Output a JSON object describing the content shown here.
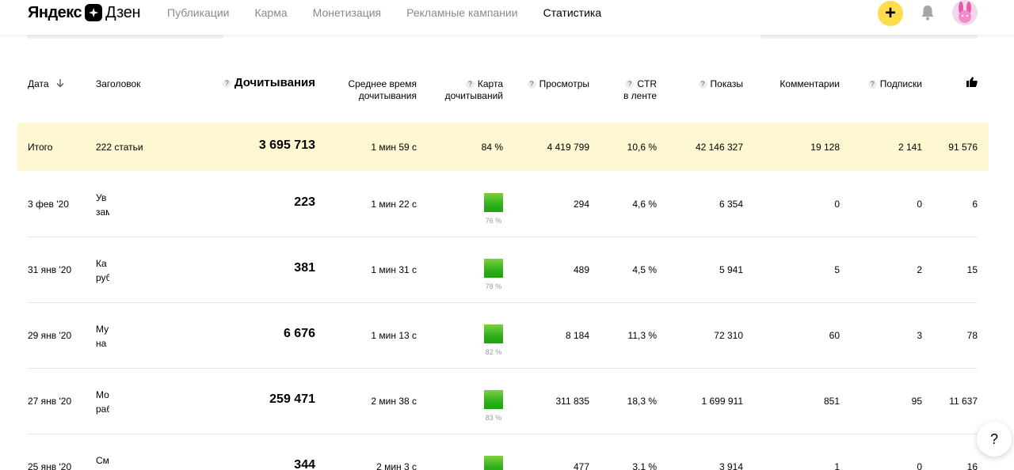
{
  "brand": {
    "yandex": "Яндекс",
    "dzen": "Дзен"
  },
  "nav": [
    {
      "label": "Публикации"
    },
    {
      "label": "Карма"
    },
    {
      "label": "Монетизация"
    },
    {
      "label": "Рекламные кампании"
    },
    {
      "label": "Статистика",
      "active": true
    }
  ],
  "header_icons": {
    "add": "+",
    "bell": "bell-icon",
    "avatar": "bunny-avatar"
  },
  "table": {
    "columns": {
      "date": "Дата",
      "title": "Заголовок",
      "reads": "Дочитывания",
      "avg_time_line1": "Среднее время",
      "avg_time_line2": "дочитывания",
      "map_line1": "Карта",
      "map_line2": "дочитываний",
      "views": "Просмотры",
      "ctr_line1": "CTR",
      "ctr_line2": "в ленте",
      "shows": "Показы",
      "comments": "Комментарии",
      "subs": "Подписки",
      "likes_icon": "thumbs-up-icon"
    },
    "help_mark": "?",
    "total": {
      "label": "Итого",
      "title": "222 статьи",
      "reads": "3 695 713",
      "avg_time": "1 мин 59 с",
      "map": "84 %",
      "views": "4 419 799",
      "ctr": "10,6 %",
      "shows": "42 146 327",
      "comments": "19 128",
      "subs": "2 141",
      "likes": "91 576"
    },
    "rows": [
      {
        "date": "3 фев '20",
        "title1": "Ув",
        "title2": "зам",
        "reads": "223",
        "avg_time": "1 мин 22 с",
        "map": "76 %",
        "views": "294",
        "ctr": "4,6 %",
        "shows": "6 354",
        "comments": "0",
        "subs": "0",
        "likes": "6"
      },
      {
        "date": "31 янв '20",
        "title1": "Ка",
        "title2": "руб",
        "reads": "381",
        "avg_time": "1 мин 31 с",
        "map": "78 %",
        "views": "489",
        "ctr": "4,5 %",
        "shows": "5 941",
        "comments": "5",
        "subs": "2",
        "likes": "15"
      },
      {
        "date": "29 янв '20",
        "title1": "Му",
        "title2": "на",
        "reads": "6 676",
        "avg_time": "1 мин 13 с",
        "map": "82 %",
        "views": "8 184",
        "ctr": "11,3 %",
        "shows": "72 310",
        "comments": "60",
        "subs": "3",
        "likes": "78"
      },
      {
        "date": "27 янв '20",
        "title1": "Мо",
        "title2": "раб",
        "reads": "259 471",
        "avg_time": "2 мин 38 с",
        "map": "83 %",
        "views": "311 835",
        "ctr": "18,3 %",
        "shows": "1 699 911",
        "comments": "851",
        "subs": "95",
        "likes": "11 637"
      },
      {
        "date": "25 янв '20",
        "title1": "См",
        "title2": "",
        "reads": "344",
        "avg_time": "2 мин 3 с",
        "map": "",
        "views": "477",
        "ctr": "3,1 %",
        "shows": "3 914",
        "comments": "1",
        "subs": "0",
        "likes": "16"
      }
    ]
  },
  "help_button": "?"
}
